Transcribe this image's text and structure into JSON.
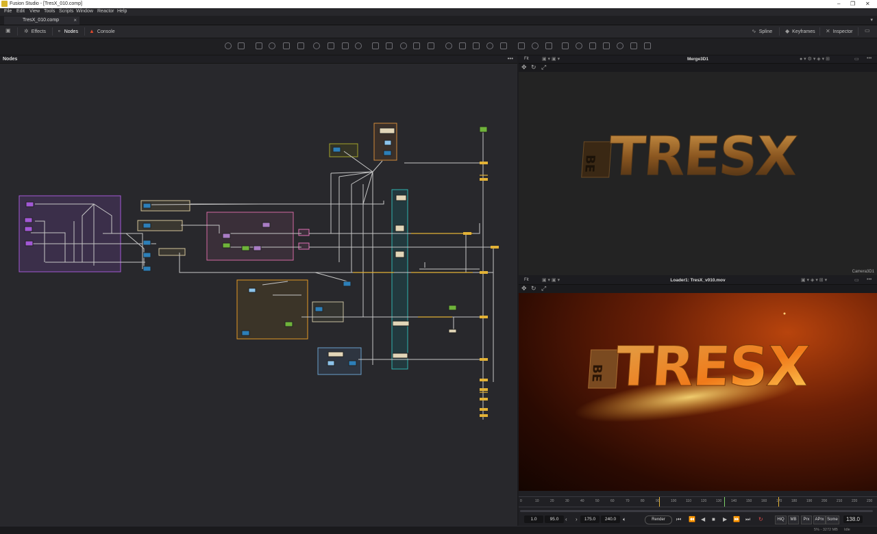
{
  "window": {
    "title": "Fusion Studio - [TresX_010.comp]"
  },
  "menu": [
    "File",
    "Edit",
    "View",
    "Tools",
    "Scripts",
    "Window",
    "Reactor",
    "Help"
  ],
  "tabs": [
    {
      "label": "TresX_010.comp"
    }
  ],
  "toolbar": {
    "left": [
      {
        "icon": "effects-icon",
        "label": "Effects"
      },
      {
        "icon": "nodes-icon",
        "label": "Nodes"
      },
      {
        "icon": "warning-icon",
        "label": "Console"
      }
    ],
    "right": [
      {
        "icon": "spline-icon",
        "label": "Spline"
      },
      {
        "icon": "keyframes-icon",
        "label": "Keyframes"
      },
      {
        "icon": "inspector-icon",
        "label": "Inspector"
      }
    ]
  },
  "nodes_panel": {
    "title": "Nodes",
    "menu": "•••"
  },
  "viewer1": {
    "fit": "Fit",
    "title": "Merge3D1",
    "overlay_label": "Camera3D1",
    "render_text": "TRESX",
    "small_text": "BE"
  },
  "viewer2": {
    "fit": "Fit",
    "title": "Loader1: TresX_v010.mov",
    "render_text": "TRESX",
    "small_text": "BE"
  },
  "timeline": {
    "ticks": [
      "0",
      "10",
      "20",
      "30",
      "40",
      "50",
      "60",
      "70",
      "80",
      "90",
      "100",
      "110",
      "120",
      "130",
      "140",
      "150",
      "160",
      "170",
      "180",
      "190",
      "200",
      "210",
      "220",
      "230"
    ],
    "global_start": "1.0",
    "render_start": "95.0",
    "render_end": "175.0",
    "global_end": "240.0",
    "render_label": "Render",
    "toggles": [
      "HiQ",
      "MB",
      "Prx",
      "APrx",
      "Some"
    ],
    "current_frame": "138.0"
  },
  "status": {
    "memory": "5% - 3272 MB",
    "state": "Idle"
  }
}
